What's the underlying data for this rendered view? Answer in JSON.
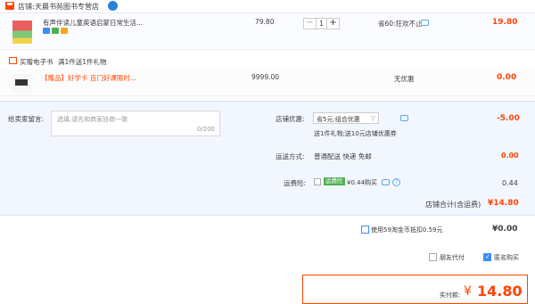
{
  "shop": {
    "label": "店铺:",
    "name": "天晨书苑图书专营店"
  },
  "item": {
    "title": "有声伴读儿童英语启蒙日常生活...",
    "price": "79.80",
    "qty": "1",
    "minus": "−",
    "plus": "+",
    "promo": "省60:狂欢不止",
    "subtotal": "19.80"
  },
  "gift_header": {
    "label": "买赠电子书",
    "desc": "满1件送1件礼物"
  },
  "gift_item": {
    "title": "【赠品】好学卡 百门好课限时...",
    "price": "9999.00",
    "discount": "无优惠",
    "subtotal": "0.00"
  },
  "message": {
    "label": "给卖家留言:",
    "placeholder": "选填,请先和商家协商一致",
    "count": "0/200"
  },
  "shop_discount": {
    "label": "店铺优惠:",
    "selected": "省5元:组合优惠",
    "detail": "送1件礼物;送10元店铺优惠券",
    "amount": "-5.00"
  },
  "delivery": {
    "label": "运送方式:",
    "value": "普通配送 快递 免邮",
    "amount": "0.00"
  },
  "freight_insurance": {
    "label": "运费险:",
    "badge": "运费险",
    "value": "¥0.44购买",
    "amount": "0.44"
  },
  "shop_total": {
    "label": "店铺合计(含运费)",
    "value": "¥14.80"
  },
  "taojinbi": {
    "label": "使用59淘金币抵扣0.59元",
    "value": "¥0.00"
  },
  "options": {
    "friend_pay": "朋友代付",
    "anonymous": "匿名购买"
  },
  "pay": {
    "label": "实付款:",
    "currency": "¥",
    "value": "14.80"
  },
  "colors": {
    "accent": "#ff4400",
    "blue": "#3d8df5",
    "green": "#4caf50"
  }
}
